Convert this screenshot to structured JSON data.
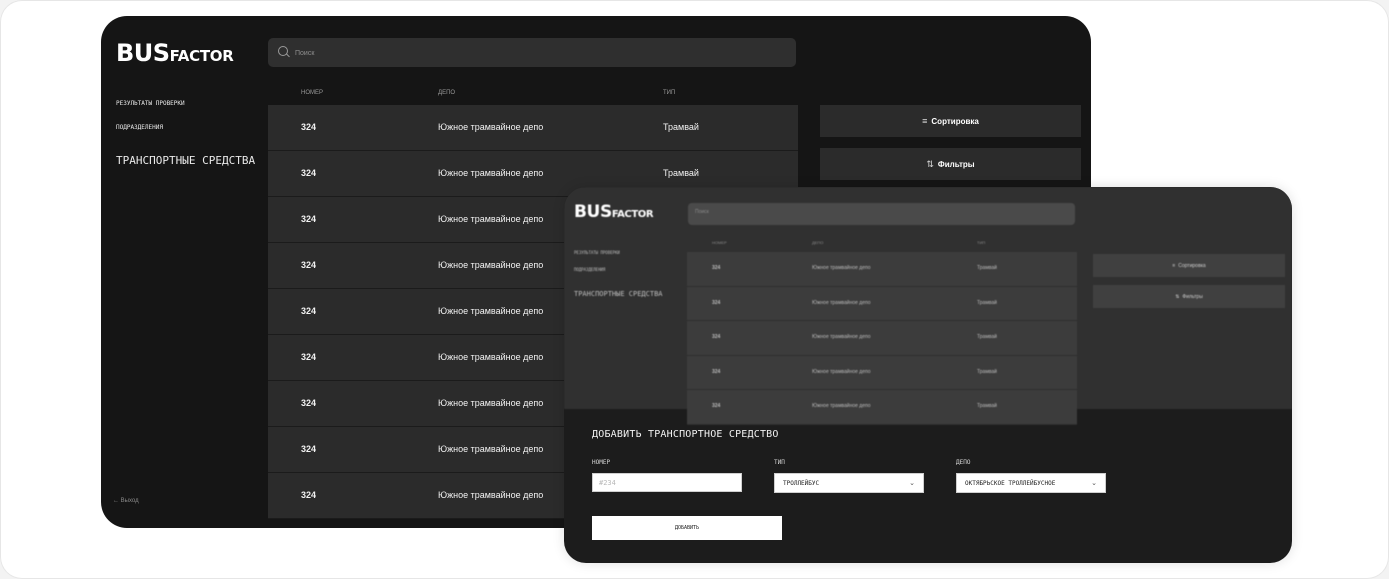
{
  "app": {
    "logo_big": "BUS",
    "logo_small": "FACTOR"
  },
  "sidebar": {
    "items": [
      {
        "label": "Результаты проверки"
      },
      {
        "label": "Подразделения"
      },
      {
        "label": "Транспортные средства"
      }
    ],
    "exit_label": "Выход"
  },
  "search": {
    "placeholder": "Поиск"
  },
  "table": {
    "columns": [
      "Номер",
      "Депо",
      "Тип"
    ],
    "rows": [
      {
        "number": "324",
        "depot": "Южное трамвайное депо",
        "type": "Трамвай"
      },
      {
        "number": "324",
        "depot": "Южное трамвайное депо",
        "type": "Трамвай"
      },
      {
        "number": "324",
        "depot": "Южное трамвайное депо",
        "type": ""
      },
      {
        "number": "324",
        "depot": "Южное трамвайное депо",
        "type": ""
      },
      {
        "number": "324",
        "depot": "Южное трамвайное депо",
        "type": ""
      },
      {
        "number": "324",
        "depot": "Южное трамвайное депо",
        "type": ""
      },
      {
        "number": "324",
        "depot": "Южное трамвайное депо",
        "type": ""
      },
      {
        "number": "324",
        "depot": "Южное трамвайное депо",
        "type": ""
      },
      {
        "number": "324",
        "depot": "Южное трамвайное депо",
        "type": ""
      }
    ]
  },
  "actions": {
    "sort_label": "Сортировка",
    "filter_label": "Фильтры",
    "sort_icon": "≡",
    "filter_icon": "⇅"
  },
  "overlay": {
    "rows": [
      {
        "number": "324",
        "depot": "Южное трамвайное депо",
        "type": "Трамвай"
      },
      {
        "number": "324",
        "depot": "Южное трамвайное депо",
        "type": "Трамвай"
      },
      {
        "number": "324",
        "depot": "Южное трамвайное депо",
        "type": "Трамвай"
      },
      {
        "number": "324",
        "depot": "Южное трамвайное депо",
        "type": "Трамвай"
      },
      {
        "number": "324",
        "depot": "Южное трамвайное депо",
        "type": "Трамвай"
      }
    ]
  },
  "form": {
    "title": "Добавить транспортное средство",
    "number_label": "Номер",
    "number_placeholder": "#234",
    "type_label": "Тип",
    "type_value": "Троллейбус",
    "depot_label": "Депо",
    "depot_value": "Октябрьское троллейбусное",
    "submit_label": "Добавить"
  },
  "colors": {
    "background": "#151515",
    "row": "#2b2b2b",
    "accent": "#ffffff"
  }
}
